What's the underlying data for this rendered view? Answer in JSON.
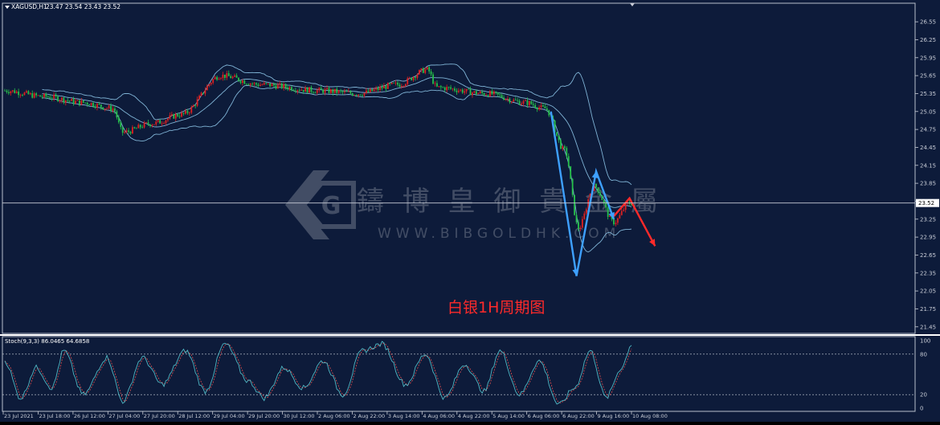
{
  "chart_window": {
    "symbol_header": "XAGUSD,H1",
    "ohlc_header": "23.47 23.54 23.43 23.52",
    "annotation_text": "白银1H周期图",
    "watermark_cn": "鑄 博 皇 御 貴 金 屬",
    "watermark_url": "WWW.BIBGOLDHK.COM",
    "current_price_label": "23.52",
    "colors": {
      "background": "#0d1b3a",
      "grid_text": "#c8ccd6",
      "bull": "#e02020",
      "bear": "#26c04a",
      "bands": "#7fb3d5",
      "blue_arrow": "#3ea0ff",
      "red_arrow": "#ff2a2a",
      "annotation": "#ff2a2a"
    }
  },
  "chart_data": [
    {
      "type": "candlestick",
      "title": "XAGUSD,H1",
      "y_ticks": [
        "26.55",
        "26.25",
        "25.95",
        "25.65",
        "25.35",
        "25.05",
        "24.75",
        "24.45",
        "24.15",
        "23.85",
        "23.55",
        "23.25",
        "22.95",
        "22.65",
        "22.35",
        "22.05",
        "21.75",
        "21.45"
      ],
      "ylim": [
        21.38,
        26.78
      ],
      "x_tick_labels": [
        "23 Jul 2021",
        "23 Jul 18:00",
        "26 Jul 12:00",
        "27 Jul 04:00",
        "27 Jul 20:00",
        "28 Jul 12:00",
        "29 Jul 04:00",
        "29 Jul 20:00",
        "30 Jul 12:00",
        "2 Aug 06:00",
        "2 Aug 22:00",
        "3 Aug 14:00",
        "4 Aug 06:00",
        "4 Aug 22:00",
        "5 Aug 14:00",
        "6 Aug 06:00",
        "6 Aug 22:00",
        "9 Aug 16:00",
        "10 Aug 08:00"
      ],
      "price_path_anchors": [
        {
          "bar": 0,
          "price": 25.4
        },
        {
          "bar": 20,
          "price": 25.3
        },
        {
          "bar": 40,
          "price": 25.2
        },
        {
          "bar": 55,
          "price": 25.1
        },
        {
          "bar": 60,
          "price": 24.7
        },
        {
          "bar": 75,
          "price": 24.85
        },
        {
          "bar": 90,
          "price": 25.0
        },
        {
          "bar": 110,
          "price": 25.65
        },
        {
          "bar": 130,
          "price": 25.5
        },
        {
          "bar": 160,
          "price": 25.4
        },
        {
          "bar": 180,
          "price": 25.35
        },
        {
          "bar": 200,
          "price": 25.5
        },
        {
          "bar": 215,
          "price": 25.75
        },
        {
          "bar": 220,
          "price": 25.45
        },
        {
          "bar": 245,
          "price": 25.35
        },
        {
          "bar": 265,
          "price": 25.2
        },
        {
          "bar": 275,
          "price": 25.1
        },
        {
          "bar": 285,
          "price": 24.4
        },
        {
          "bar": 292,
          "price": 23.1
        },
        {
          "bar": 300,
          "price": 23.8
        },
        {
          "bar": 310,
          "price": 23.2
        },
        {
          "bar": 318,
          "price": 23.52
        }
      ],
      "current_price": 23.52,
      "blue_zigzag_prices": [
        25.05,
        22.3,
        24.05,
        23.25
      ],
      "red_projection_prices": [
        23.3,
        23.6,
        22.8
      ],
      "indicator": {
        "label": "Stoch(9,3,3) 86.0465 64.6858",
        "y_ticks": [
          "100",
          "80",
          "20",
          "0"
        ],
        "levels": [
          80,
          20
        ],
        "main_color": "#4fb7c4",
        "signal_color": "#e05050",
        "k_anchors": [
          {
            "bar": 0,
            "v": 70
          },
          {
            "bar": 8,
            "v": 15
          },
          {
            "bar": 16,
            "v": 60
          },
          {
            "bar": 24,
            "v": 30
          },
          {
            "bar": 30,
            "v": 85
          },
          {
            "bar": 40,
            "v": 20
          },
          {
            "bar": 52,
            "v": 75
          },
          {
            "bar": 60,
            "v": 10
          },
          {
            "bar": 70,
            "v": 75
          },
          {
            "bar": 80,
            "v": 35
          },
          {
            "bar": 92,
            "v": 85
          },
          {
            "bar": 102,
            "v": 25
          },
          {
            "bar": 112,
            "v": 95
          },
          {
            "bar": 124,
            "v": 40
          },
          {
            "bar": 132,
            "v": 15
          },
          {
            "bar": 142,
            "v": 60
          },
          {
            "bar": 152,
            "v": 30
          },
          {
            "bar": 162,
            "v": 70
          },
          {
            "bar": 172,
            "v": 20
          },
          {
            "bar": 182,
            "v": 85
          },
          {
            "bar": 192,
            "v": 95
          },
          {
            "bar": 204,
            "v": 35
          },
          {
            "bar": 214,
            "v": 80
          },
          {
            "bar": 224,
            "v": 15
          },
          {
            "bar": 234,
            "v": 65
          },
          {
            "bar": 244,
            "v": 25
          },
          {
            "bar": 252,
            "v": 85
          },
          {
            "bar": 262,
            "v": 20
          },
          {
            "bar": 272,
            "v": 70
          },
          {
            "bar": 282,
            "v": 5
          },
          {
            "bar": 290,
            "v": 30
          },
          {
            "bar": 298,
            "v": 85
          },
          {
            "bar": 306,
            "v": 15
          },
          {
            "bar": 314,
            "v": 60
          },
          {
            "bar": 319,
            "v": 95
          }
        ]
      }
    }
  ]
}
